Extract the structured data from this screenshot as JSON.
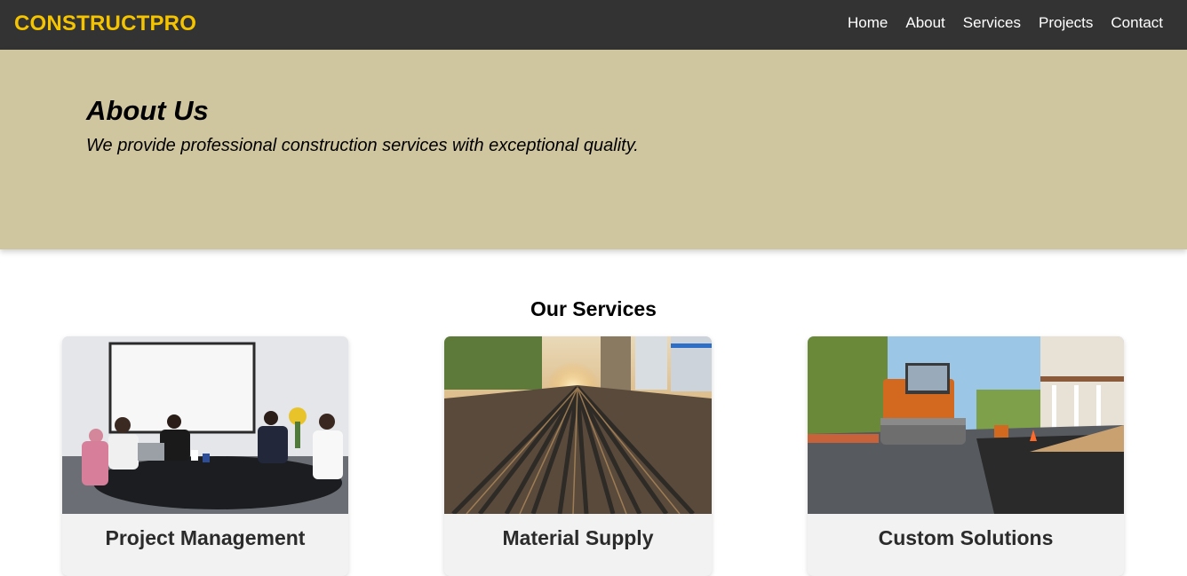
{
  "brand": {
    "logo_text": "CONSTRUCTPRO",
    "accent": "#f5c400"
  },
  "nav": {
    "items": [
      {
        "label": "Home"
      },
      {
        "label": "About"
      },
      {
        "label": "Services"
      },
      {
        "label": "Projects"
      },
      {
        "label": "Contact"
      }
    ]
  },
  "hero": {
    "title": "About Us",
    "subtitle": "We provide professional construction services with exceptional quality.",
    "bg_color": "#cfc6a0"
  },
  "services": {
    "heading": "Our Services",
    "cards": [
      {
        "title": "Project Management",
        "image_icon": "meeting-photo"
      },
      {
        "title": "Material Supply",
        "image_icon": "rebar-photo"
      },
      {
        "title": "Custom Solutions",
        "image_icon": "road-construction-photo"
      }
    ]
  }
}
